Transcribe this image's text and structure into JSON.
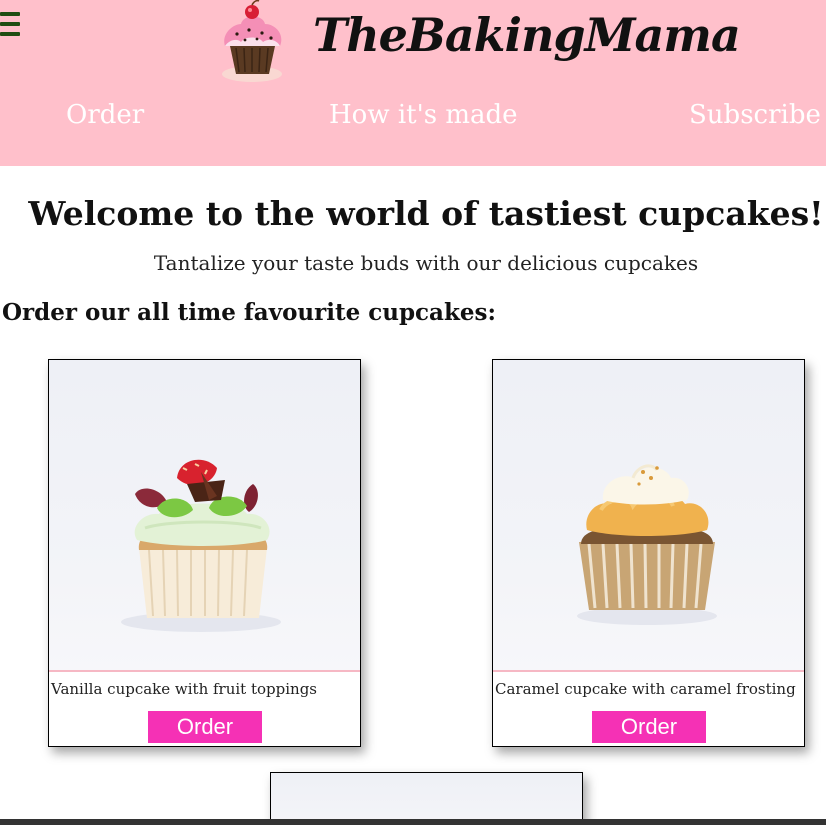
{
  "header": {
    "brand": "TheBakingMama",
    "menu_icon": "hamburger-menu-icon",
    "logo_icon": "cupcake-logo-icon",
    "background_color": "#ffc0cb"
  },
  "nav": {
    "items": [
      {
        "label": "Order"
      },
      {
        "label": "How it's made"
      },
      {
        "label": "Subscribe"
      }
    ]
  },
  "main": {
    "welcome": "Welcome to the world of tastiest cupcakes!",
    "tagline": "Tantalize your taste buds with our delicious cupcakes",
    "section_title": "Order our all time favourite cupcakes:",
    "products": [
      {
        "caption": "Vanilla cupcake with fruit toppings",
        "button": "Order",
        "image": "vanilla-cupcake-image"
      },
      {
        "caption": "Caramel cupcake with caramel frosting",
        "button": "Order",
        "image": "caramel-cupcake-image"
      },
      {
        "caption": "",
        "button": "",
        "image": "cupcake-image"
      }
    ],
    "button_color": "#f531b5"
  }
}
